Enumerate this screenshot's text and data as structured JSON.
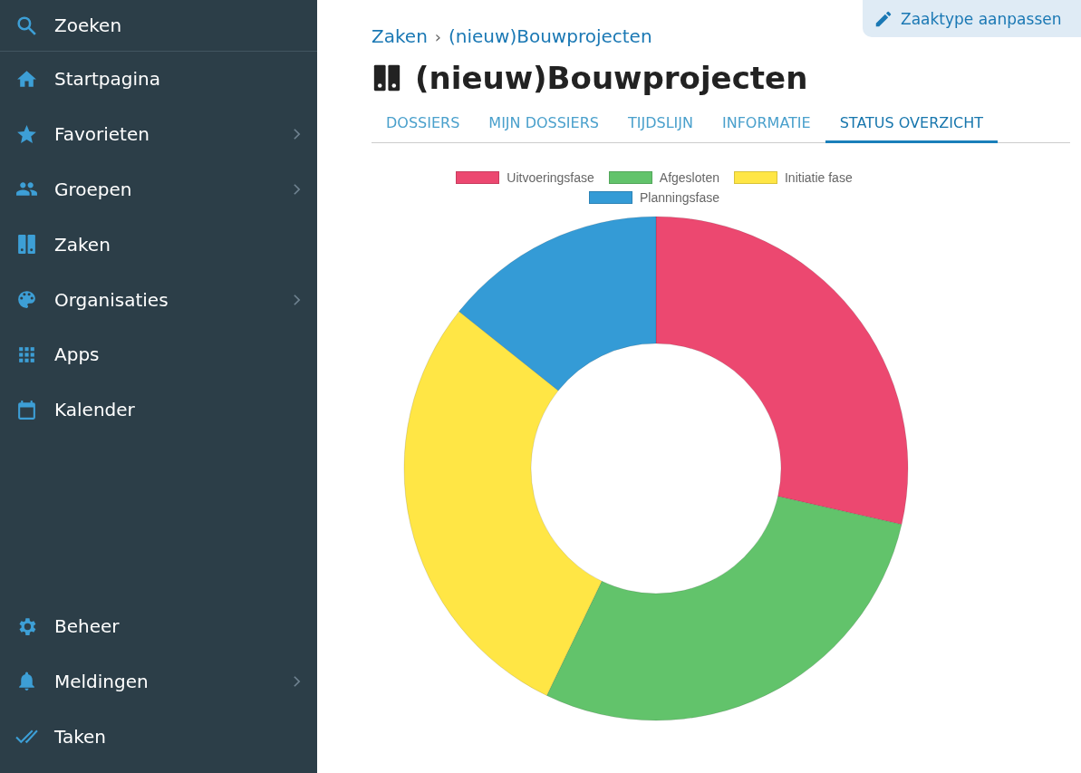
{
  "sidebar": {
    "search": {
      "label": "Zoeken"
    },
    "items": [
      {
        "label": "Startpagina",
        "has_submenu": false
      },
      {
        "label": "Favorieten",
        "has_submenu": true
      },
      {
        "label": "Groepen",
        "has_submenu": true
      },
      {
        "label": "Zaken",
        "has_submenu": false
      },
      {
        "label": "Organisaties",
        "has_submenu": true
      },
      {
        "label": "Apps",
        "has_submenu": false
      },
      {
        "label": "Kalender",
        "has_submenu": false
      }
    ],
    "bottom_items": [
      {
        "label": "Beheer",
        "has_submenu": false
      },
      {
        "label": "Meldingen",
        "has_submenu": true
      },
      {
        "label": "Taken",
        "has_submenu": false
      }
    ]
  },
  "edit_button": {
    "label": "Zaaktype aanpassen"
  },
  "breadcrumb": [
    {
      "label": "Zaken"
    },
    {
      "label": "(nieuw)Bouwprojecten"
    }
  ],
  "breadcrumb_separator": "›",
  "title": "(nieuw)Bouwprojecten",
  "tabs": [
    {
      "label": "DOSSIERS",
      "selected": false
    },
    {
      "label": "MIJN DOSSIERS",
      "selected": false
    },
    {
      "label": "TIJDSLIJN",
      "selected": false
    },
    {
      "label": "INFORMATIE",
      "selected": false
    },
    {
      "label": "STATUS OVERZICHT",
      "selected": true
    }
  ],
  "legend": [
    {
      "label": "Uitvoeringsfase",
      "color": "#ec4870"
    },
    {
      "label": "Afgesloten",
      "color": "#62c36b"
    },
    {
      "label": "Initiatie fase",
      "color": "#ffe645"
    },
    {
      "label": "Planningsfase",
      "color": "#349bd6"
    }
  ]
}
